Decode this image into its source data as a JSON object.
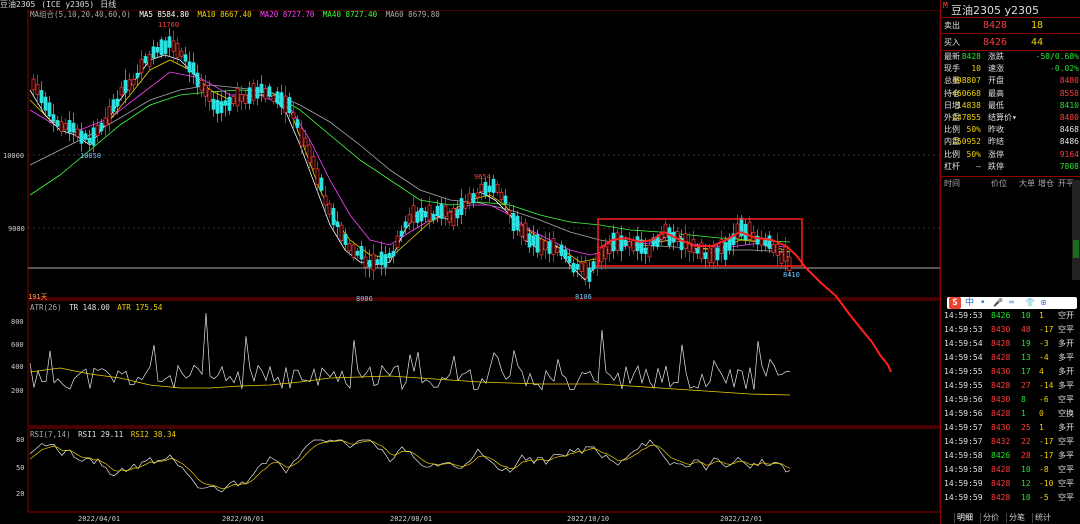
{
  "title": {
    "code": "豆油2305",
    "name": "(ICE y2305)",
    "period": "日线",
    "ma_label": "MA组合(5,10,20,40,60,0)",
    "ma": [
      {
        "label": "MA5 8584.80",
        "color": "#ffffff"
      },
      {
        "label": "MA10 8667.40",
        "color": "#f0d000"
      },
      {
        "label": "MA20 8727.70",
        "color": "#ff40ff"
      },
      {
        "label": "MA40 8727.40",
        "color": "#40ff40"
      },
      {
        "label": "MA60 8679.80",
        "color": "#aaaaaa"
      }
    ]
  },
  "price_axis": [
    "10000",
    "9000"
  ],
  "annotations": [
    "11760",
    "10050",
    "9654",
    "8086",
    "8106",
    "8410"
  ],
  "vol_tag": "191天",
  "atr": {
    "label": "ATR(26)",
    "tr": "TR 148.00",
    "atr": "ATR 175.54",
    "axis": [
      "800",
      "600",
      "400",
      "200"
    ]
  },
  "rsi": {
    "label": "RSI(7,14)",
    "r1": "RSI1 29.11",
    "r2": "RSI2 38.34",
    "axis": [
      "80",
      "50",
      "20"
    ]
  },
  "dates": [
    "2022/04/01",
    "2022/06/01",
    "2022/08/01",
    "2022/10/10",
    "2022/12/01"
  ],
  "panel": {
    "marker": "M",
    "title": "豆油2305  y2305",
    "sell": {
      "label": "卖出",
      "price": "8428",
      "qty": "18"
    },
    "buy": {
      "label": "买入",
      "price": "8426",
      "qty": "44"
    },
    "stats": [
      [
        "最新",
        "8428",
        "涨跌",
        "-58/0.68%"
      ],
      [
        "现手",
        "10",
        "速涨",
        "-0.02%"
      ],
      [
        "总量",
        "498807",
        "开盘",
        "8480"
      ],
      [
        "持仓",
        "460668",
        "最高",
        "8558"
      ],
      [
        "日增",
        "14838",
        "最低",
        "8410"
      ],
      [
        "外盘",
        "247855",
        "结算价▾",
        "8480"
      ],
      [
        "比例",
        "50%",
        "昨收",
        "8468"
      ],
      [
        "内盘",
        "250952",
        "昨结",
        "8486"
      ],
      [
        "比例",
        "50%",
        "涨停",
        "9164"
      ],
      [
        "杠杆",
        "—",
        "跌停",
        "7808"
      ]
    ],
    "tick_header": [
      "时间",
      "价位",
      "大单",
      "增仓",
      "开平"
    ],
    "ticks": [
      [
        "14:59:53",
        "8426",
        "10",
        "1",
        "空开"
      ],
      [
        "14:59:53",
        "8430",
        "48",
        "-17",
        "空平"
      ],
      [
        "14:59:54",
        "8428",
        "19",
        "-3",
        "多开"
      ],
      [
        "14:59:54",
        "8428",
        "13",
        "-4",
        "多平"
      ],
      [
        "14:59:55",
        "8430",
        "17",
        "4",
        "多开"
      ],
      [
        "14:59:55",
        "8428",
        "27",
        "-14",
        "多平"
      ],
      [
        "14:59:56",
        "8430",
        "8",
        "-6",
        "空平"
      ],
      [
        "14:59:56",
        "8428",
        "1",
        "0",
        "空换"
      ],
      [
        "14:59:57",
        "8430",
        "25",
        "1",
        "多开"
      ],
      [
        "14:59:57",
        "8432",
        "22",
        "-17",
        "空平"
      ],
      [
        "14:59:58",
        "8426",
        "28",
        "-17",
        "多平"
      ],
      [
        "14:59:58",
        "8428",
        "10",
        "-8",
        "空平"
      ],
      [
        "14:59:59",
        "8428",
        "12",
        "-10",
        "空平"
      ],
      [
        "14:59:59",
        "8428",
        "10",
        "-5",
        "空平"
      ]
    ],
    "ime": [
      "S",
      "中",
      "•",
      "🎤",
      "⌨",
      "👕",
      "⊞"
    ],
    "tabs": [
      "明细",
      "分价",
      "分笔",
      "统计"
    ]
  }
}
